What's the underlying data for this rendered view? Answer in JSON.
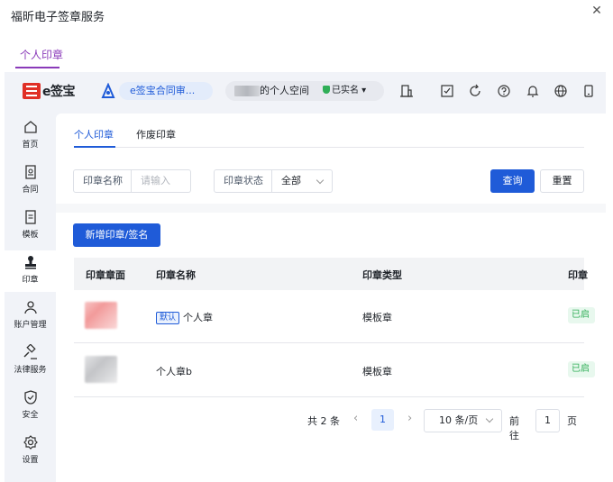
{
  "dialog": {
    "title": "福昕电子签章服务",
    "tab": "个人印章",
    "close_glyph": "✕"
  },
  "topbar": {
    "logo": "e签宝",
    "app_name": "e签宝合同审...",
    "space_name": "的个人空间",
    "verified": "已实名",
    "icons": [
      "building-icon",
      "checkbox-icon",
      "refresh-icon",
      "help-icon",
      "bell-icon",
      "globe-icon",
      "mobile-icon"
    ]
  },
  "sidebar": {
    "items": [
      {
        "label": "首页",
        "icon": "home-icon"
      },
      {
        "label": "合同",
        "icon": "contract-icon"
      },
      {
        "label": "模板",
        "icon": "template-icon"
      },
      {
        "label": "印章",
        "icon": "seal-icon",
        "active": true
      },
      {
        "label": "账户管理",
        "icon": "user-icon"
      },
      {
        "label": "法律服务",
        "icon": "gavel-icon"
      },
      {
        "label": "安全",
        "icon": "shield-icon"
      },
      {
        "label": "设置",
        "icon": "gear-icon"
      }
    ]
  },
  "tabs": [
    {
      "label": "个人印章",
      "active": true
    },
    {
      "label": "作废印章"
    }
  ],
  "filters": {
    "name_label": "印章名称",
    "name_placeholder": "请输入",
    "status_label": "印章状态",
    "status_value": "全部",
    "search_button": "查询",
    "reset_button": "重置"
  },
  "add_button": "新增印章/签名",
  "table": {
    "headers": [
      "印章章面",
      "印章名称",
      "印章类型",
      "印章"
    ],
    "rows": [
      {
        "default_tag": "默认",
        "name": "个人章",
        "type": "模板章",
        "status": "已启用",
        "seal_color": "pink"
      },
      {
        "default_tag": "",
        "name": "个人章b",
        "type": "模板章",
        "status": "已启用",
        "seal_color": "gray"
      }
    ]
  },
  "pagination": {
    "total": "共 2 条",
    "prev": "‹",
    "page": "1",
    "next": "›",
    "page_size": "10 条/页",
    "goto_label": "前往",
    "goto_value": "1",
    "goto_suffix": "页"
  },
  "colors": {
    "accent": "#1f5bd8",
    "dialog_accent": "#8a3ab9",
    "brand_red": "#e02f26",
    "success": "#2fae57"
  }
}
